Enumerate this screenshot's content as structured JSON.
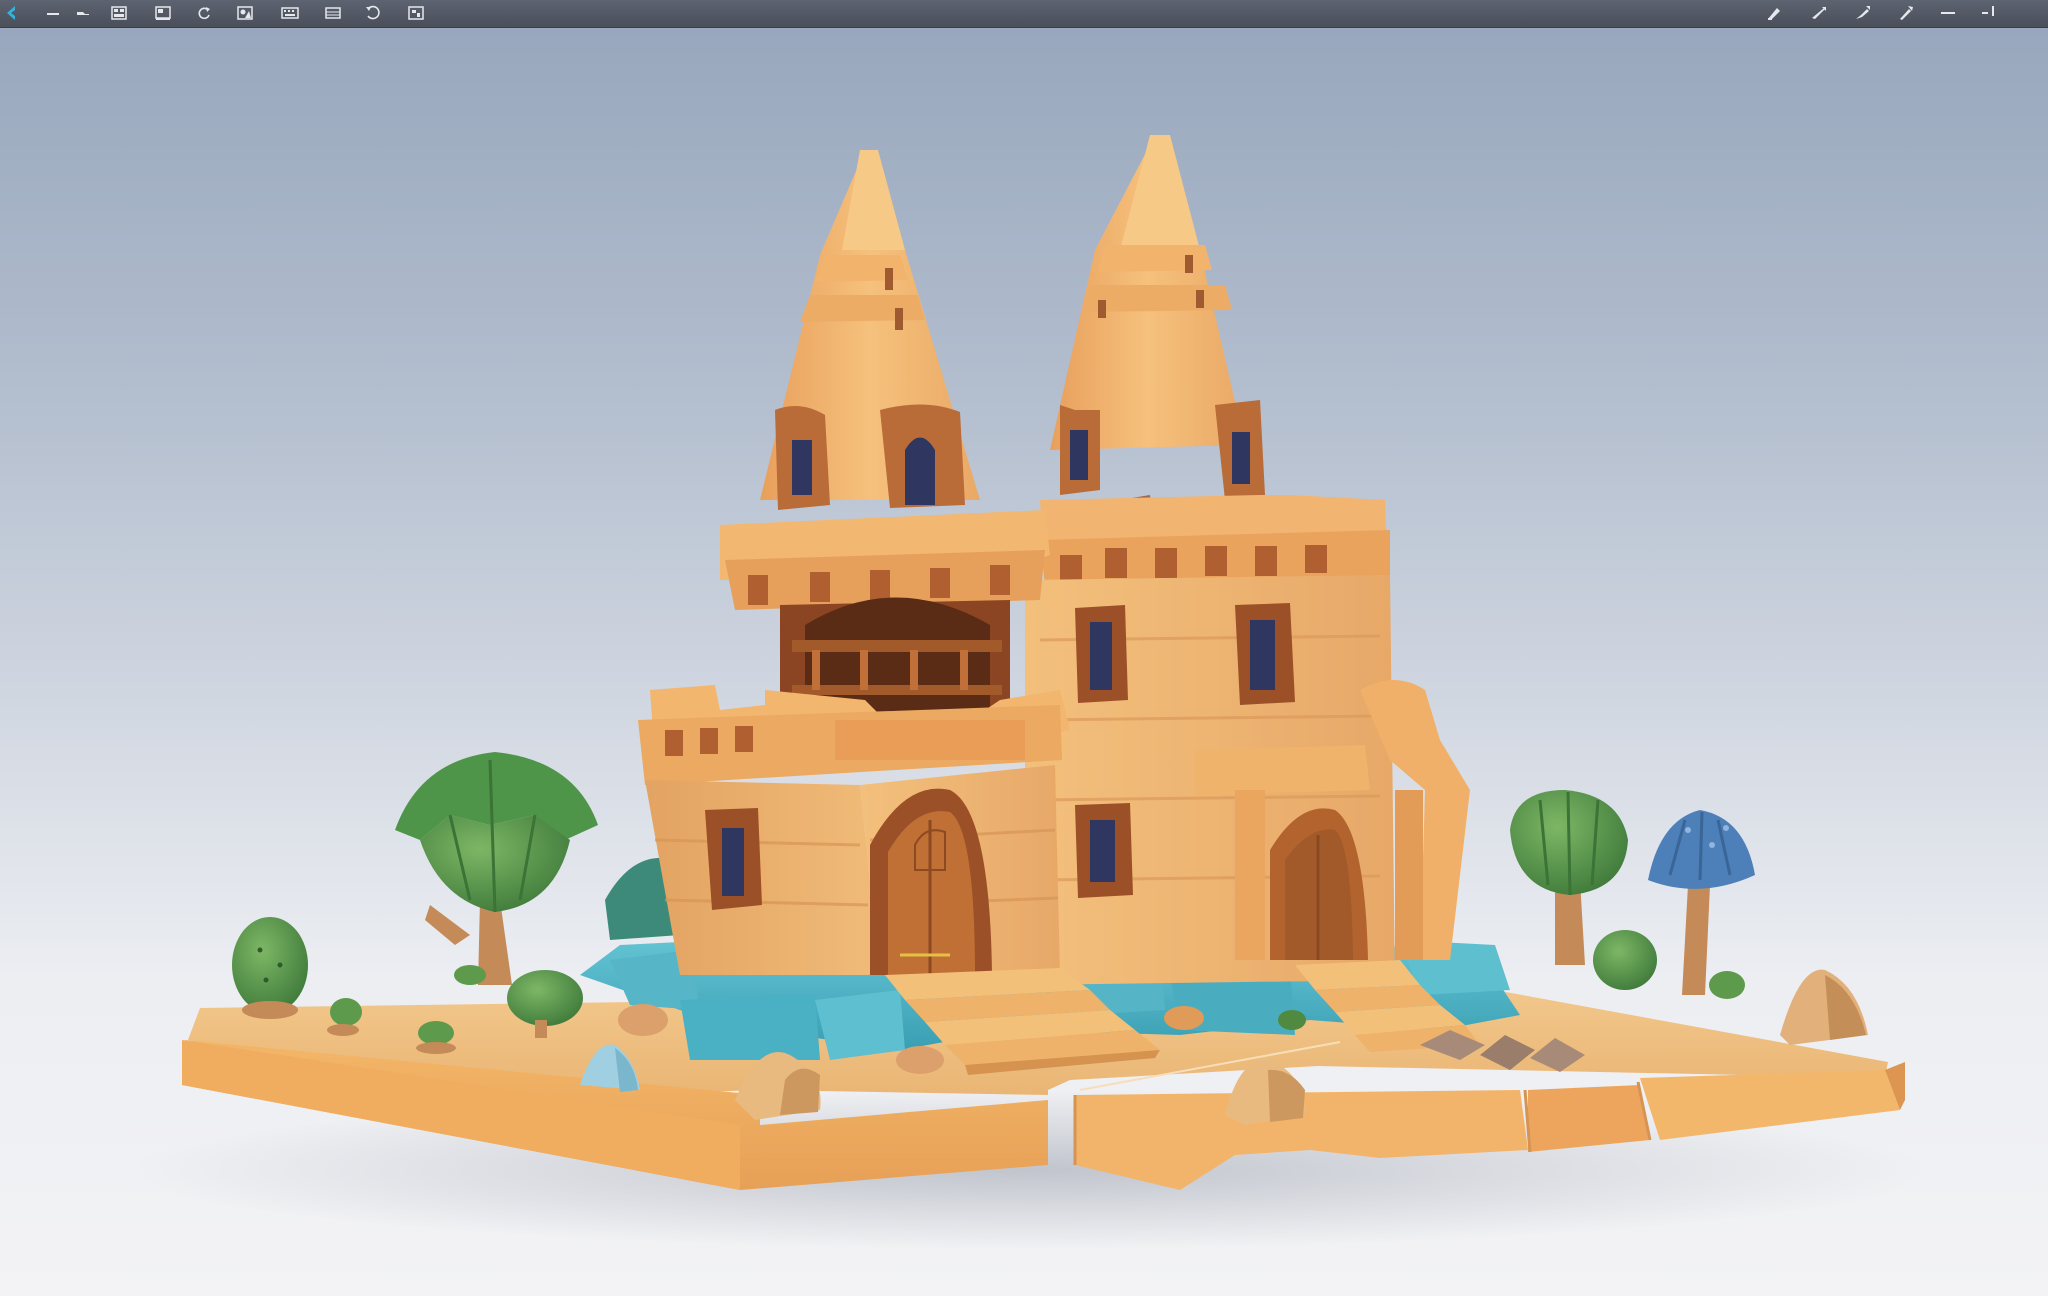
{
  "app": {
    "toolbar_left": [
      {
        "name": "minimize-panel-icon"
      },
      {
        "name": "collapse-panel-icon"
      },
      {
        "name": "layout-grid-icon"
      },
      {
        "name": "layout-split-icon"
      },
      {
        "name": "refresh-icon"
      },
      {
        "name": "render-icon"
      },
      {
        "name": "keyboard-icon"
      },
      {
        "name": "film-strip-icon"
      },
      {
        "name": "rotate-view-icon"
      },
      {
        "name": "cube-3d-icon"
      }
    ],
    "toolbar_right": [
      {
        "name": "move-tool-icon"
      },
      {
        "name": "select-tool-icon"
      },
      {
        "name": "draw-tool-icon"
      },
      {
        "name": "pen-tool-icon"
      },
      {
        "name": "minimize-window-icon"
      },
      {
        "name": "pin-icon"
      }
    ]
  },
  "colors": {
    "toolbar": "#4f5460",
    "sand_light": "#f4b96d",
    "sand_dark": "#c7804a",
    "trim": "#8f4b25",
    "water": "#4fb2c6",
    "foliage": "#5e9a4c",
    "mushroom_cap": "#4d7fb8"
  }
}
